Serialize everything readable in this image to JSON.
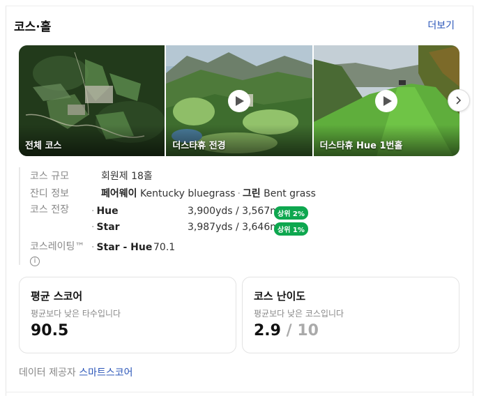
{
  "header": {
    "title": "코스·홀",
    "more": "더보기"
  },
  "gallery": {
    "items": [
      {
        "caption": "전체 코스",
        "video": false
      },
      {
        "caption": "더스타휴 전경",
        "video": true
      },
      {
        "caption": "더스타휴 Hue 1번홀",
        "video": true
      }
    ]
  },
  "info": {
    "size": {
      "label": "코스 규모",
      "value": "회원제 18홀"
    },
    "turf": {
      "label": "잔디 정보",
      "fairway_label": "페어웨이",
      "fairway_value": "Kentucky bluegrass",
      "green_label": "그린",
      "green_value": "Bent grass"
    },
    "length": {
      "label": "코스 전장",
      "rows": [
        {
          "name": "Hue",
          "distance": "3,900yds / 3,567m",
          "rank": "상위 2%"
        },
        {
          "name": "Star",
          "distance": "3,987yds / 3,646m",
          "rank": "상위 1%"
        }
      ]
    },
    "rating": {
      "label": "코스레이팅™",
      "info_icon": "i",
      "name": "Star - Hue",
      "value": "70.1"
    }
  },
  "scores": {
    "avg": {
      "title": "평균 스코어",
      "sub": "평균보다 낮은 타수입니다",
      "value": "90.5"
    },
    "difficulty": {
      "title": "코스 난이도",
      "sub": "평균보다 낮은 코스입니다",
      "value": "2.9",
      "max": "/ 10"
    }
  },
  "provider": {
    "label": "데이터 제공자",
    "link": "스마트스코어"
  },
  "colors": {
    "accent": "#2a55b8",
    "rank_badge": "#0ea74f"
  }
}
